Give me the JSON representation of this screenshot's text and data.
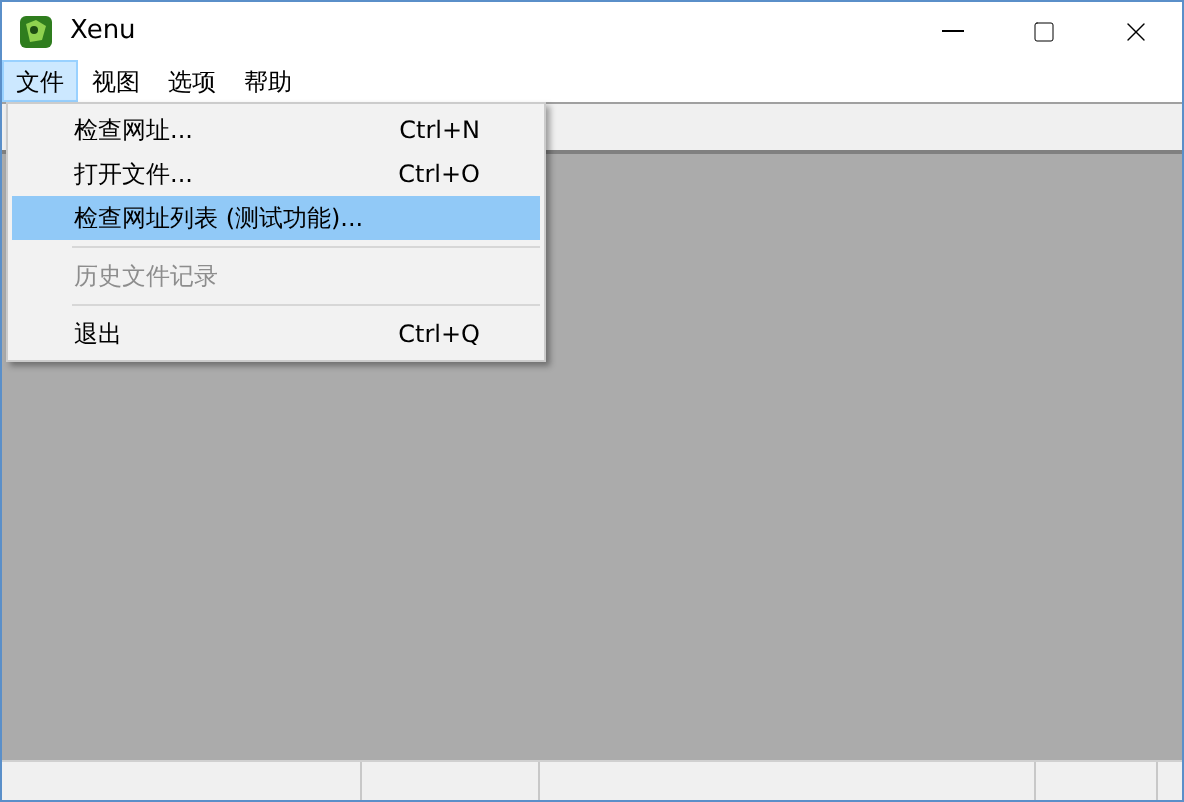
{
  "window": {
    "title": "Xenu"
  },
  "menu_bar": [
    {
      "label": "文件",
      "selected": true
    },
    {
      "label": "视图",
      "selected": false
    },
    {
      "label": "选项",
      "selected": false
    },
    {
      "label": "帮助",
      "selected": false
    }
  ],
  "dropdown": [
    {
      "kind": "item",
      "label": "检查网址...",
      "shortcut": "Ctrl+N",
      "selected": false,
      "disabled": false
    },
    {
      "kind": "item",
      "label": "打开文件...",
      "shortcut": "Ctrl+O",
      "selected": false,
      "disabled": false
    },
    {
      "kind": "item",
      "label": "检查网址列表 (测试功能)...",
      "selected": true,
      "disabled": false
    },
    {
      "kind": "separator"
    },
    {
      "kind": "item",
      "label": "历史文件记录",
      "selected": false,
      "disabled": true
    },
    {
      "kind": "separator"
    },
    {
      "kind": "item",
      "label": "退出",
      "shortcut": "Ctrl+Q",
      "selected": false,
      "disabled": false
    }
  ]
}
